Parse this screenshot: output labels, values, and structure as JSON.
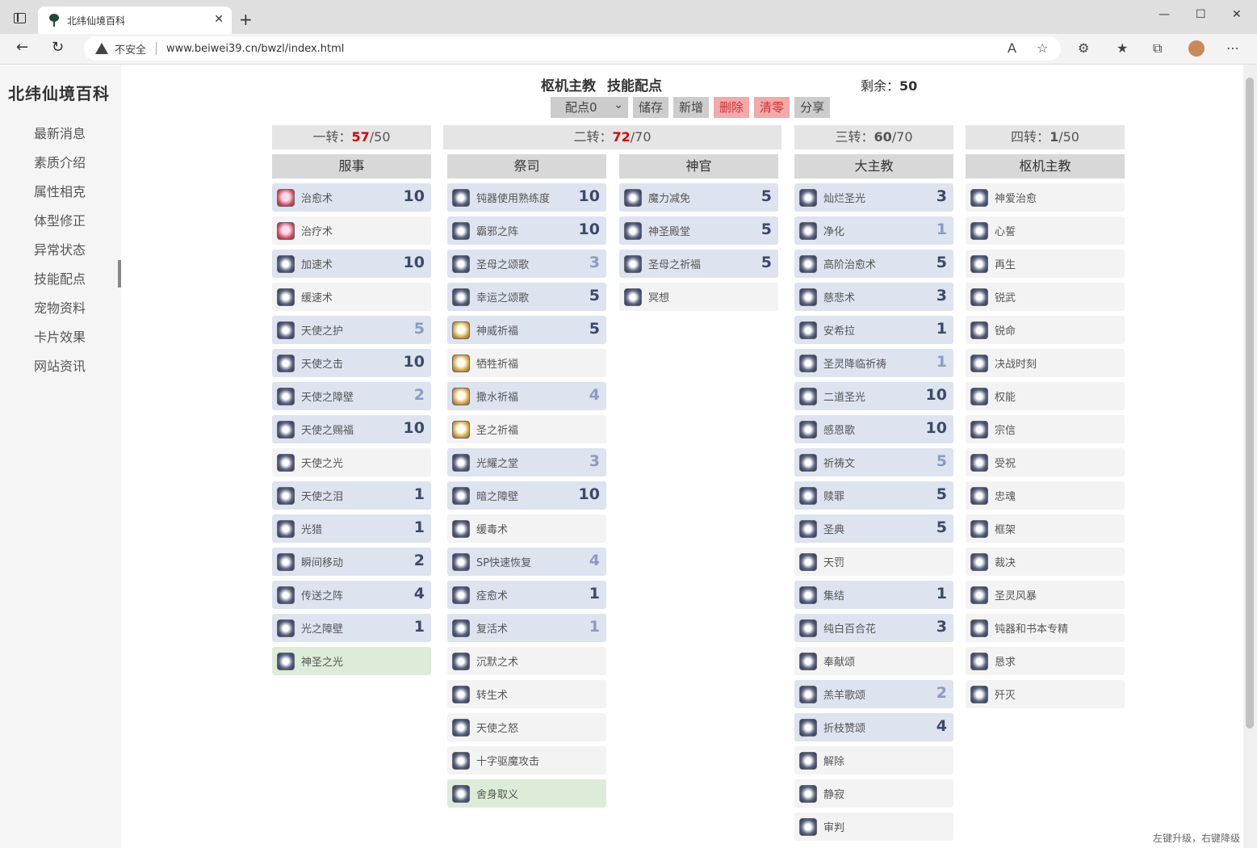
{
  "browser": {
    "tab_title": "北纬仙境百科",
    "security": "不安全",
    "url": "www.beiwei39.cn/bwzl/index.html"
  },
  "sidebar": {
    "title": "北纬仙境百科",
    "items": [
      "最新消息",
      "素质介绍",
      "属性相克",
      "体型修正",
      "异常状态",
      "技能配点",
      "宠物资料",
      "卡片效果",
      "网站资讯"
    ],
    "active": "技能配点"
  },
  "header": {
    "job": "枢机主教",
    "page": "技能配点",
    "remain_label": "剩余：",
    "remain_value": "50"
  },
  "toolbar": {
    "preset": "配点0",
    "save": "储存",
    "add": "新增",
    "delete": "删除",
    "clear": "清零",
    "share": "分享"
  },
  "turns": [
    {
      "label": "一转：",
      "used": "57",
      "max": "/50",
      "over": true
    },
    {
      "label": "二转：",
      "used": "72",
      "max": "/70",
      "over": true
    },
    {
      "label": "三转：",
      "used": "60",
      "max": "/70",
      "over": false
    },
    {
      "label": "四转：",
      "used": "1",
      "max": "/50",
      "over": false
    }
  ],
  "columns": [
    {
      "name": "服事",
      "skills": [
        {
          "name": "治愈术",
          "level": "10",
          "state": "max"
        },
        {
          "name": "治疗术",
          "level": "",
          "state": "none"
        },
        {
          "name": "加速术",
          "level": "10",
          "state": "max"
        },
        {
          "name": "缓速术",
          "level": "",
          "state": "none"
        },
        {
          "name": "天使之护",
          "level": "5",
          "state": "part"
        },
        {
          "name": "天使之击",
          "level": "10",
          "state": "max"
        },
        {
          "name": "天使之障壁",
          "level": "2",
          "state": "part"
        },
        {
          "name": "天使之赐福",
          "level": "10",
          "state": "max"
        },
        {
          "name": "天使之光",
          "level": "",
          "state": "none"
        },
        {
          "name": "天使之泪",
          "level": "1",
          "state": "max"
        },
        {
          "name": "光猎",
          "level": "1",
          "state": "max"
        },
        {
          "name": "瞬间移动",
          "level": "2",
          "state": "max"
        },
        {
          "name": "传送之阵",
          "level": "4",
          "state": "max"
        },
        {
          "name": "光之障壁",
          "level": "1",
          "state": "max"
        },
        {
          "name": "神圣之光",
          "level": "",
          "state": "hl"
        }
      ]
    },
    {
      "name": "祭司",
      "skills": [
        {
          "name": "钝器使用熟练度",
          "level": "10",
          "state": "max"
        },
        {
          "name": "霸邪之阵",
          "level": "10",
          "state": "max"
        },
        {
          "name": "圣母之颂歌",
          "level": "3",
          "state": "part"
        },
        {
          "name": "幸运之颂歌",
          "level": "5",
          "state": "max"
        },
        {
          "name": "神威祈福",
          "level": "5",
          "state": "max"
        },
        {
          "name": "牺牲祈福",
          "level": "",
          "state": "none"
        },
        {
          "name": "撒水祈福",
          "level": "4",
          "state": "part"
        },
        {
          "name": "圣之祈福",
          "level": "",
          "state": "none"
        },
        {
          "name": "光耀之堂",
          "level": "3",
          "state": "part"
        },
        {
          "name": "暗之障壁",
          "level": "10",
          "state": "max"
        },
        {
          "name": "缓毒术",
          "level": "",
          "state": "none"
        },
        {
          "name": "SP快速恢复",
          "level": "4",
          "state": "part"
        },
        {
          "name": "痊愈术",
          "level": "1",
          "state": "max"
        },
        {
          "name": "复活术",
          "level": "1",
          "state": "part"
        },
        {
          "name": "沉默之术",
          "level": "",
          "state": "none"
        },
        {
          "name": "转生术",
          "level": "",
          "state": "none"
        },
        {
          "name": "天使之怒",
          "level": "",
          "state": "none"
        },
        {
          "name": "十字驱魔攻击",
          "level": "",
          "state": "none"
        },
        {
          "name": "舍身取义",
          "level": "",
          "state": "hl"
        }
      ]
    },
    {
      "name": "神官",
      "skills": [
        {
          "name": "魔力减免",
          "level": "5",
          "state": "max"
        },
        {
          "name": "神圣殿堂",
          "level": "5",
          "state": "max"
        },
        {
          "name": "圣母之祈福",
          "level": "5",
          "state": "max"
        },
        {
          "name": "冥想",
          "level": "",
          "state": "none"
        }
      ]
    },
    {
      "name": "大主教",
      "skills": [
        {
          "name": "灿烂圣光",
          "level": "3",
          "state": "max"
        },
        {
          "name": "净化",
          "level": "1",
          "state": "part"
        },
        {
          "name": "高阶治愈术",
          "level": "5",
          "state": "max"
        },
        {
          "name": "慈悲术",
          "level": "3",
          "state": "max"
        },
        {
          "name": "安希拉",
          "level": "1",
          "state": "max"
        },
        {
          "name": "圣灵降临祈祷",
          "level": "1",
          "state": "part"
        },
        {
          "name": "二道圣光",
          "level": "10",
          "state": "max"
        },
        {
          "name": "感恩歌",
          "level": "10",
          "state": "max"
        },
        {
          "name": "祈祷文",
          "level": "5",
          "state": "part"
        },
        {
          "name": "赎罪",
          "level": "5",
          "state": "max"
        },
        {
          "name": "圣典",
          "level": "5",
          "state": "max"
        },
        {
          "name": "天罚",
          "level": "",
          "state": "none"
        },
        {
          "name": "集结",
          "level": "1",
          "state": "max"
        },
        {
          "name": "纯白百合花",
          "level": "3",
          "state": "max"
        },
        {
          "name": "奉献颂",
          "level": "",
          "state": "none"
        },
        {
          "name": "羔羊歌颂",
          "level": "2",
          "state": "part"
        },
        {
          "name": "折枝赞颂",
          "level": "4",
          "state": "max"
        },
        {
          "name": "解除",
          "level": "",
          "state": "none"
        },
        {
          "name": "静寂",
          "level": "",
          "state": "none"
        },
        {
          "name": "审判",
          "level": "",
          "state": "none"
        }
      ]
    },
    {
      "name": "枢机主教",
      "skills": [
        {
          "name": "神爱治愈",
          "level": "",
          "state": "none"
        },
        {
          "name": "心誓",
          "level": "",
          "state": "none"
        },
        {
          "name": "再生",
          "level": "",
          "state": "none"
        },
        {
          "name": "锐武",
          "level": "",
          "state": "none"
        },
        {
          "name": "锐命",
          "level": "",
          "state": "none"
        },
        {
          "name": "决战时刻",
          "level": "",
          "state": "none"
        },
        {
          "name": "权能",
          "level": "",
          "state": "none"
        },
        {
          "name": "宗信",
          "level": "",
          "state": "none"
        },
        {
          "name": "受祝",
          "level": "",
          "state": "none"
        },
        {
          "name": "忠魂",
          "level": "",
          "state": "none"
        },
        {
          "name": "框架",
          "level": "",
          "state": "none"
        },
        {
          "name": "裁决",
          "level": "",
          "state": "none"
        },
        {
          "name": "圣灵风暴",
          "level": "",
          "state": "none"
        },
        {
          "name": "钝器和书本专精",
          "level": "",
          "state": "none"
        },
        {
          "name": "恳求",
          "level": "",
          "state": "none"
        },
        {
          "name": "歼灭",
          "level": "",
          "state": "none"
        }
      ]
    }
  ],
  "hint": "左键升级，右键降级"
}
